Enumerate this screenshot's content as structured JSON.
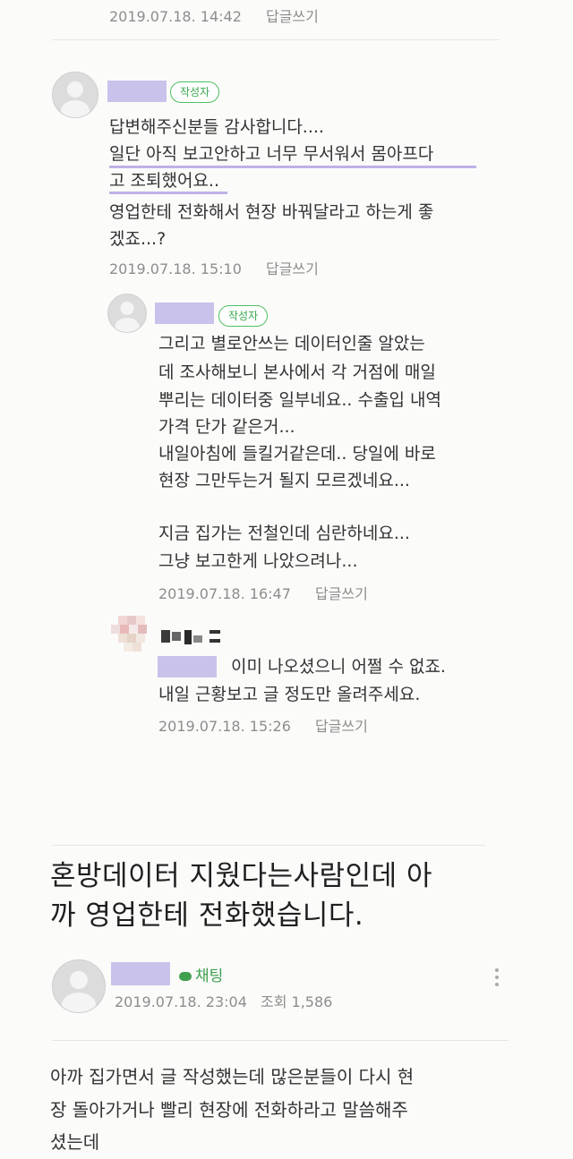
{
  "top_comment": {
    "date": "2019.07.18. 14:42",
    "reply": "답글쓰기"
  },
  "comment1": {
    "badge": "작성자",
    "lines": [
      "답변해주신분들 감사합니다....",
      "일단 아직 보고안하고 너무 무서워서 몸아프다",
      "고 조퇴했어요..",
      "영업한테 전화해서 현장 바꿔달라고 하는게 좋",
      "겠죠...?"
    ],
    "date": "2019.07.18. 15:10",
    "reply": "답글쓰기"
  },
  "comment2": {
    "badge": "작성자",
    "lines": [
      "그리고 별로안쓰는 데이터인줄 알았는",
      "데 조사해보니 본사에서 각 거점에 매일",
      "뿌리는 데이터중 일부네요.. 수출입 내역",
      "가격 단가 같은거...",
      "내일아침에 들킬거같은데.. 당일에 바로",
      "현장 그만두는거 될지 모르겠네요...",
      "",
      "지금 집가는 전철인데 심란하네요...",
      "그냥 보고한게 나았으려나..."
    ],
    "date": "2019.07.18. 16:47",
    "reply": "답글쓰기"
  },
  "comment3": {
    "line1": "이미 나오셨으니 어쩔 수 없죠.",
    "line2": "내일 근황보고 글 정도만 올려주세요.",
    "date": "2019.07.18. 15:26",
    "reply": "답글쓰기"
  },
  "post": {
    "title_line1": "혼방데이터 지웠다는사람인데 아",
    "title_line2": "까 영업한테 전화했습니다.",
    "chat_label": "채팅",
    "date": "2019.07.18. 23:04",
    "views": "조회 1,586",
    "body_line1": "아까 집가면서 글 작성했는데 많은분들이 다시 현",
    "body_line2": "장 돌아가거나 빨리 현장에 전화하라고 말씀해주",
    "body_line3": "셨는데"
  },
  "colors": {
    "name_mask": "#c9c2ea",
    "badge_green": "#4fbf62",
    "meta_gray": "#8d8d8d"
  }
}
